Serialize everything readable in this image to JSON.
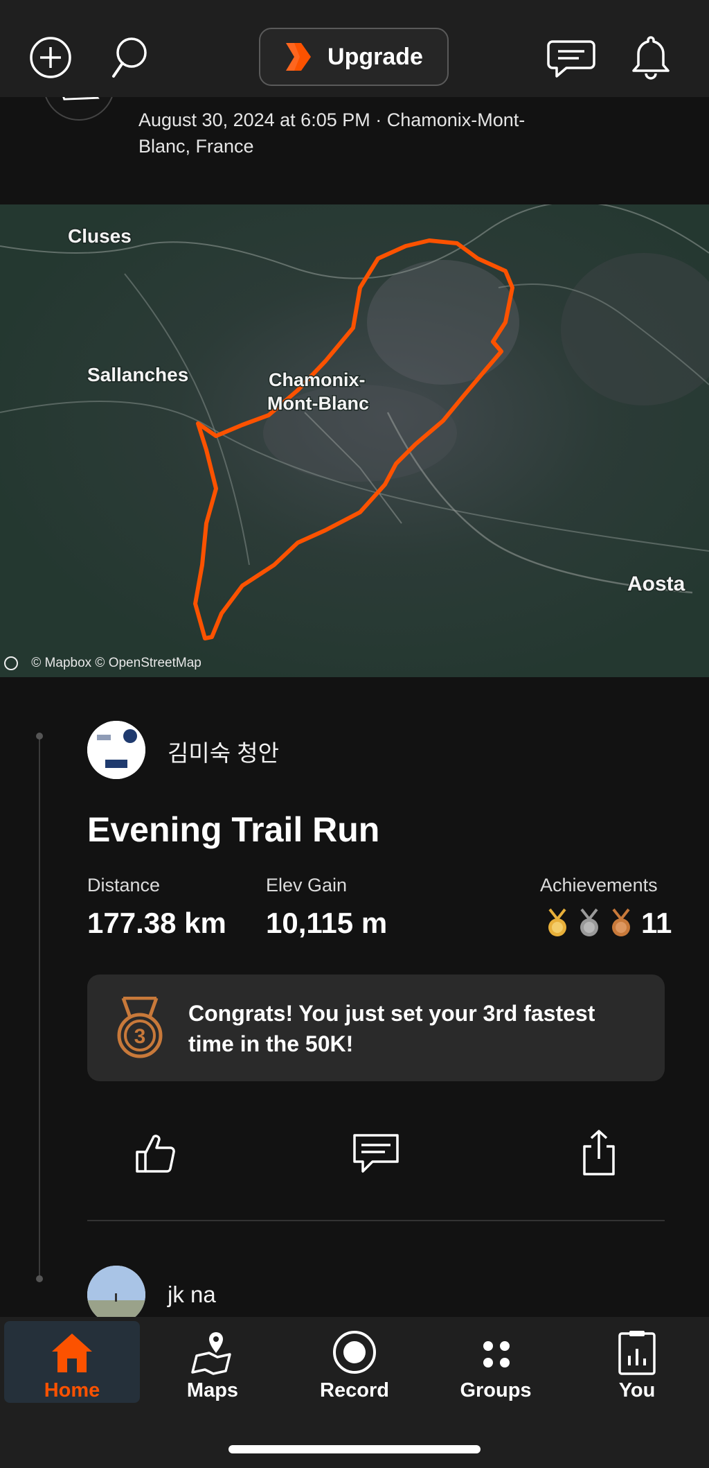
{
  "header": {
    "add_icon": "plus-circle-icon",
    "search_icon": "search-icon",
    "upgrade_label": "Upgrade",
    "messages_icon": "chat-icon",
    "notifications_icon": "bell-icon"
  },
  "activity_meta": {
    "datetime_location": "August 30, 2024 at 6:05 PM · Chamonix-Mont-Blanc, France"
  },
  "map": {
    "places": [
      "Cluses",
      "Sallanches",
      "Chamonix-Mont-Blanc",
      "Aosta"
    ],
    "attribution": "© Mapbox © OpenStreetMap",
    "route_color": "#fc5200"
  },
  "activity": {
    "athlete_name": "김미숙 청안",
    "title": "Evening Trail Run",
    "stats": [
      {
        "label": "Distance",
        "value": "177.38 km"
      },
      {
        "label": "Elev Gain",
        "value": "10,115 m"
      },
      {
        "label": "Achievements",
        "value": "11"
      }
    ],
    "achievement_medals": [
      "gold",
      "silver",
      "bronze"
    ],
    "congrats_text": "Congrats! You just set your 3rd fastest time in the 50K!",
    "actions": [
      "kudos-icon",
      "comment-icon",
      "share-icon"
    ]
  },
  "next_activity": {
    "athlete_name": "jk na"
  },
  "bottom_nav": {
    "items": [
      {
        "label": "Home",
        "icon": "home-icon",
        "active": true
      },
      {
        "label": "Maps",
        "icon": "maps-icon",
        "active": false
      },
      {
        "label": "Record",
        "icon": "record-icon",
        "active": false
      },
      {
        "label": "Groups",
        "icon": "groups-icon",
        "active": false
      },
      {
        "label": "You",
        "icon": "you-icon",
        "active": false
      }
    ]
  },
  "colors": {
    "accent": "#fc5200",
    "background": "#121212",
    "bar": "#1f1f1f",
    "gold": "#e8b03a",
    "silver": "#9a9a9a",
    "bronze": "#c8793a"
  }
}
